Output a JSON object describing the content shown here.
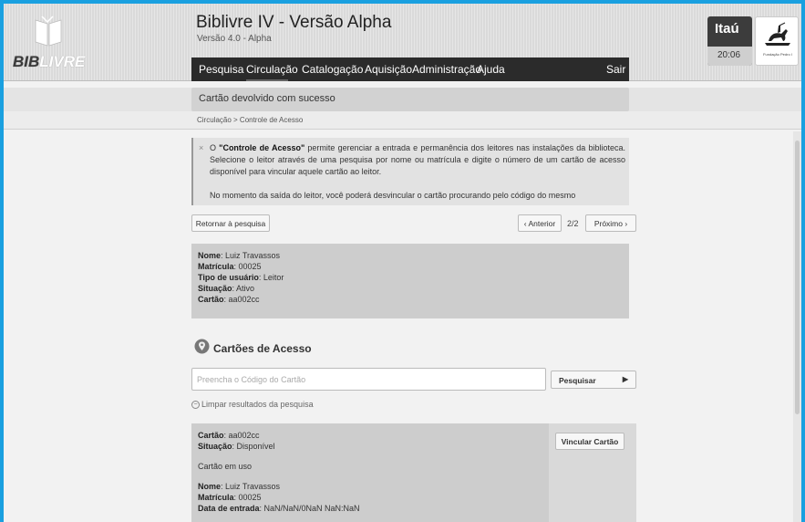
{
  "header": {
    "logo_text_bold": "BIB",
    "logo_text_light": "LIVRE",
    "app_title": "Biblivre IV - Versão Alpha",
    "app_version": "Versão 4.0 - Alpha",
    "menu": [
      "Pesquisa",
      "Circulação",
      "Catalogação",
      "Aquisição",
      "Administração",
      "Ajuda"
    ],
    "logout": "Sair",
    "sponsor": "Itaú",
    "time": "20:06",
    "foundation_name": "Fundação Pedro I"
  },
  "status": {
    "message": "Cartão devolvido com sucesso",
    "breadcrumb": "Circulação > Controle de Acesso"
  },
  "info": {
    "close": "×",
    "p1_before": "O ",
    "p1_bold": "\"Controle de Acesso\"",
    "p1_after": " permite gerenciar a entrada e permanência dos leitores nas instalações da biblioteca. Selecione o leitor através de uma pesquisa por nome ou matrícula e digite o número de um cartão de acesso disponível para vincular aquele cartão ao leitor.",
    "p2": "No momento da saída do leitor, você poderá desvincular o cartão procurando pelo código do mesmo"
  },
  "nav": {
    "back": "Retornar à pesquisa",
    "prev": "‹ Anterior",
    "count": "2/2",
    "next": "Próximo ›"
  },
  "reader": {
    "name_label": "Nome",
    "name": ": Luiz Travassos",
    "id_label": "Matrícula",
    "id": ": 00025",
    "type_label": "Tipo de usuário",
    "type": ": Leitor",
    "status_label": "Situação",
    "status": ": Ativo",
    "card_label": "Cartão",
    "card": ": aa002cc"
  },
  "access": {
    "title": "Cartões de Acesso",
    "placeholder": "Preencha o Código do Cartão",
    "search_button": "Pesquisar",
    "clear": "Limpar resultados da pesquisa"
  },
  "result": {
    "card_label": "Cartão",
    "card": ": aa002cc",
    "status_label": "Situação",
    "status": ": Disponível",
    "in_use": "Cartão em uso",
    "name_label": "Nome",
    "name": ": Luiz Travassos",
    "id_label": "Matrícula",
    "id": ": 00025",
    "entry_label": "Data de entrada",
    "entry": ": NaN/NaN/0NaN NaN:NaN",
    "link_button": "Vincular Cartão"
  }
}
